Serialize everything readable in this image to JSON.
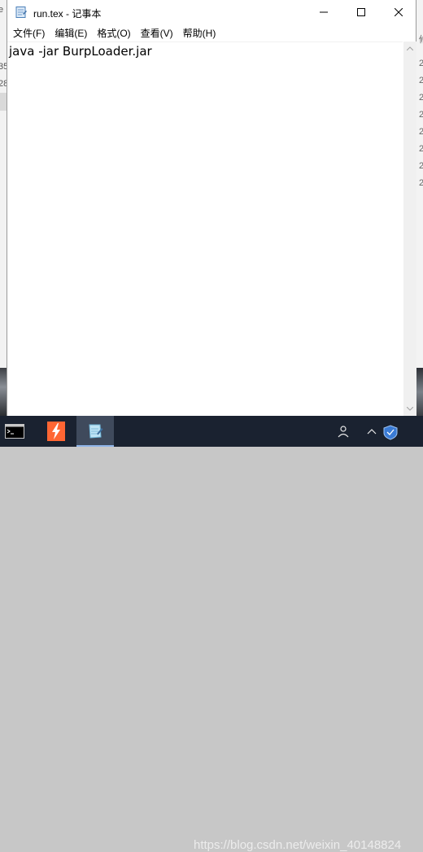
{
  "window": {
    "title": "run.tex - 记事本"
  },
  "menu": [
    "文件(F)",
    "编辑(E)",
    "格式(O)",
    "查看(V)",
    "帮助(H)"
  ],
  "editor": {
    "content": "java -jar BurpLoader.jar"
  },
  "background": {
    "left_fragments": [
      "e",
      "35",
      "28"
    ],
    "right_fragments": [
      "修",
      "2",
      "2",
      "2",
      "2",
      "2",
      "2",
      "2",
      "2"
    ]
  },
  "taskbar": {
    "apps": [
      {
        "icon": "cmd-icon",
        "active": false
      },
      {
        "icon": "burp-suite-icon",
        "active": false
      },
      {
        "icon": "notepad-icon",
        "active": true
      }
    ],
    "tray": [
      "person-icon",
      "chevron-up-icon",
      "shield-icon"
    ]
  },
  "watermark": "https://blog.csdn.net/weixin_40148824",
  "colors": {
    "taskbar_bg": "#1a2230",
    "active_task_bg": "#3f4a5c",
    "burp_orange": "#ff6633",
    "window_bg": "#ffffff"
  }
}
